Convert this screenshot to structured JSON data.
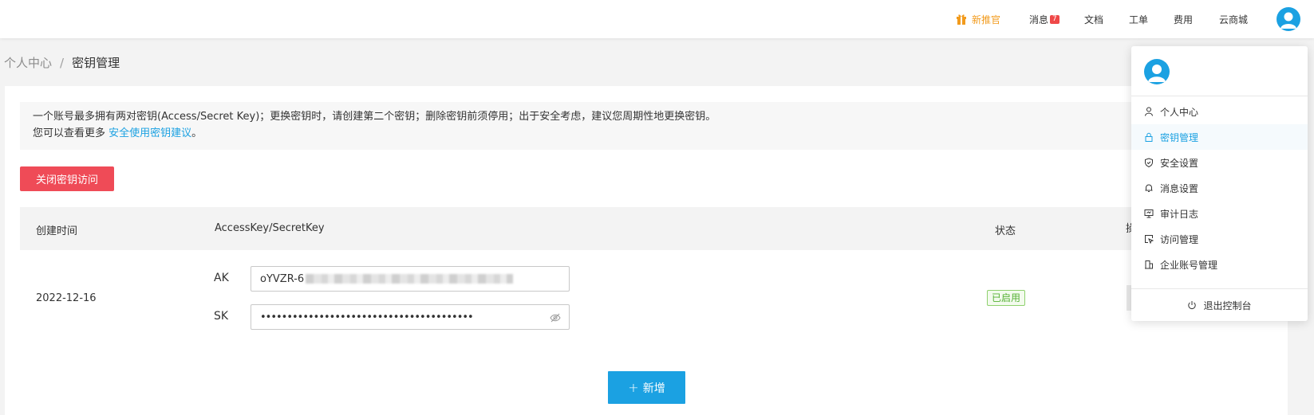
{
  "topnav": {
    "promo": "新推官",
    "messages": "消息",
    "messages_badge": "7",
    "docs": "文档",
    "ticket": "工单",
    "fees": "费用",
    "mall": "云商城"
  },
  "breadcrumb": {
    "parent": "个人中心",
    "separator": "/",
    "current": "密钥管理"
  },
  "notice": {
    "line1": "一个账号最多拥有两对密钥(Access/Secret Key)；更换密钥时，请创建第二个密钥；删除密钥前须停用；出于安全考虑，建议您周期性地更换密钥。",
    "line2_prefix": "您可以查看更多 ",
    "line2_link": "安全使用密钥建议",
    "line2_suffix": "。"
  },
  "actions": {
    "close_access": "关闭密钥访问",
    "add": "新增"
  },
  "table": {
    "columns": {
      "created": "创建时间",
      "keys": "AccessKey/SecretKey",
      "status": "状态",
      "ops_partial": "操"
    },
    "rows": [
      {
        "created": "2022-12-16",
        "ak_label": "AK",
        "ak_value": "oYVZR-6",
        "sk_label": "SK",
        "sk_value": "••••••••••••••••••••••••••••••••••••••••",
        "status": "已启用"
      }
    ]
  },
  "dropdown": {
    "items": [
      {
        "label": "个人中心",
        "icon": "user-icon"
      },
      {
        "label": "密钥管理",
        "icon": "lock-icon"
      },
      {
        "label": "安全设置",
        "icon": "shield-icon"
      },
      {
        "label": "消息设置",
        "icon": "bell-icon"
      },
      {
        "label": "审计日志",
        "icon": "monitor-icon"
      },
      {
        "label": "访问管理",
        "icon": "cursor-icon"
      },
      {
        "label": "企业账号管理",
        "icon": "building-icon"
      }
    ],
    "logout": "退出控制台"
  },
  "colors": {
    "accent": "#1ba1e2",
    "danger": "#ef4b57",
    "promo": "#f29b1d",
    "success": "#55b134"
  }
}
